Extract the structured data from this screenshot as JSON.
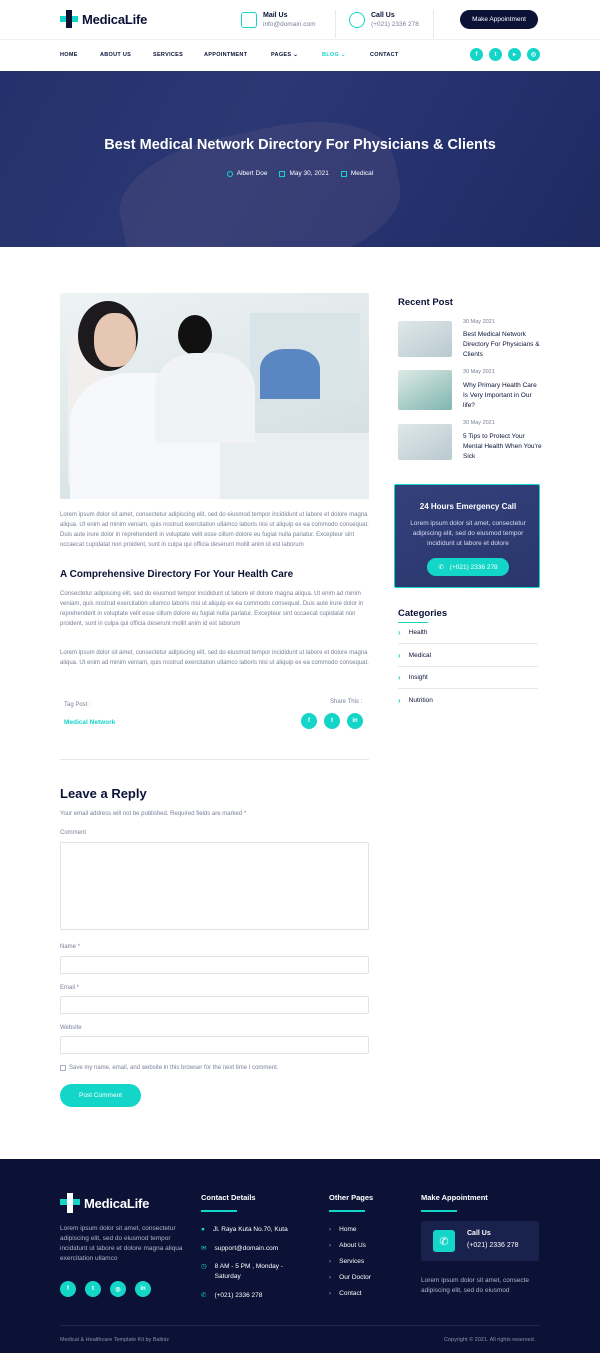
{
  "brand": {
    "name": "MedicaLife"
  },
  "header": {
    "mail": {
      "label": "Mail Us",
      "value": "info@domain.com"
    },
    "call": {
      "label": "Call Us",
      "value": "(+021) 2336 278"
    },
    "cta": "Make Appointment"
  },
  "nav": {
    "items": [
      "HOME",
      "ABOUT US",
      "SERVICES",
      "APPOINTMENT",
      "PAGES",
      "BLOG",
      "CONTACT"
    ]
  },
  "hero": {
    "title": "Best Medical Network Directory For Physicians & Clients",
    "author": "Albert Doe",
    "date": "May 30, 2021",
    "category": "Medical"
  },
  "article": {
    "p1": "Lorem ipsum dolor sit amet, consectetur adipiscing elit, sed do eiusmod tempor incididunt ut labore et dolore magna aliqua. Ut enim ad minim veniam, quis nostrud exercitation ullamco laboris nisi ut aliquip ex ea commodo consequat. Duis aute irure dolor in reprehenderit in voluptate velit esse cillum dolore eu fugiat nulla pariatur. Excepteur sint occaecat cupidatat non proident, sunt in culpa qui officia deserunt mollit anim id est laborum",
    "heading": "A Comprehensive Directory For Your Health Care",
    "p2": "Consectetur adipiscing elit, sed do eiusmod tempor incididunt ut labore et dolore magna aliqua. Ut enim ad minim veniam, quis nostrud exercitation ullamco laboris nisi ut aliquip ex ea commodo consequat. Duis aute irure dolor in reprehenderit in voluptate velit esse cillum dolore eu fugiat nulla pariatur. Excepteur sint occaecat cupidatat non proident, sunt in culpa qui officia deserunt mollit anim id est laborum",
    "p3": "Lorem ipsum dolor sit amet, consectetur adipiscing elit, sed do eiusmod tempor incididunt ut labore et dolore magna aliqua. Ut enim ad minim veniam, quis nostrud exercitation ullamco laboris nisi ut aliquip ex ea commodo consequat.",
    "tag_label": "Tag Post :",
    "tag": "Medical Network",
    "share_label": "Share This :"
  },
  "reply": {
    "title": "Leave a Reply",
    "note": "Your email address will not be published. Required fields are marked *",
    "comment": "Comment",
    "name": "Name *",
    "email": "Email *",
    "website": "Website",
    "save": "Save my name, email, and website in this browser for the next time I comment.",
    "submit": "Post Comment"
  },
  "sidebar": {
    "recent_title": "Recent Post",
    "posts": [
      {
        "date": "30 May 2021",
        "title": "Best Medical Network Directory For Physicians & Clients"
      },
      {
        "date": "30 May 2021",
        "title": "Why Primary Health Care Is Very Important in Our life?"
      },
      {
        "date": "30 May 2021",
        "title": "5 Tips to Protect Your Mental Health When You're Sick"
      }
    ],
    "emergency": {
      "title": "24 Hours Emergency Call",
      "text": "Lorem ipsum dolor sit amet, consectetur adipiscing elit, sed do eiusmod tempor incididunt ut labore et dolore",
      "phone": "(+021) 2336 278"
    },
    "categories_title": "Categories",
    "categories": [
      "Health",
      "Medical",
      "Insight",
      "Nutrition"
    ]
  },
  "footer": {
    "about": "Lorem ipsum dolor sit amet, consectetur adipiscing elit, sed do eiusmod tempor incididunt ut labore et dolore magna aliqua exercitation ullamco",
    "contact_title": "Contact Details",
    "address": "Jl. Raya Kuta No.70, Kuta",
    "email": "support@domain.com",
    "hours": "8 AM - 5 PM , Monday - Saturday",
    "phone": "(+021) 2336 278",
    "pages_title": "Other Pages",
    "pages": [
      "Home",
      "About Us",
      "Services",
      "Our Doctor",
      "Contact"
    ],
    "appt_title": "Make Appointment",
    "call_label": "Call Us",
    "call_value": "(+021) 2336 278",
    "appt_text": "Lorem ipsum dolor sit amet, consecte adipiscing elit, sed do eiusmod",
    "credit": "Medical & Healthcare Template Kit by Baliniz",
    "copyright": "Copyright © 2021. All rights reserved."
  },
  "colors": {
    "accent": "#14d6c8",
    "navy": "#0b1236"
  }
}
